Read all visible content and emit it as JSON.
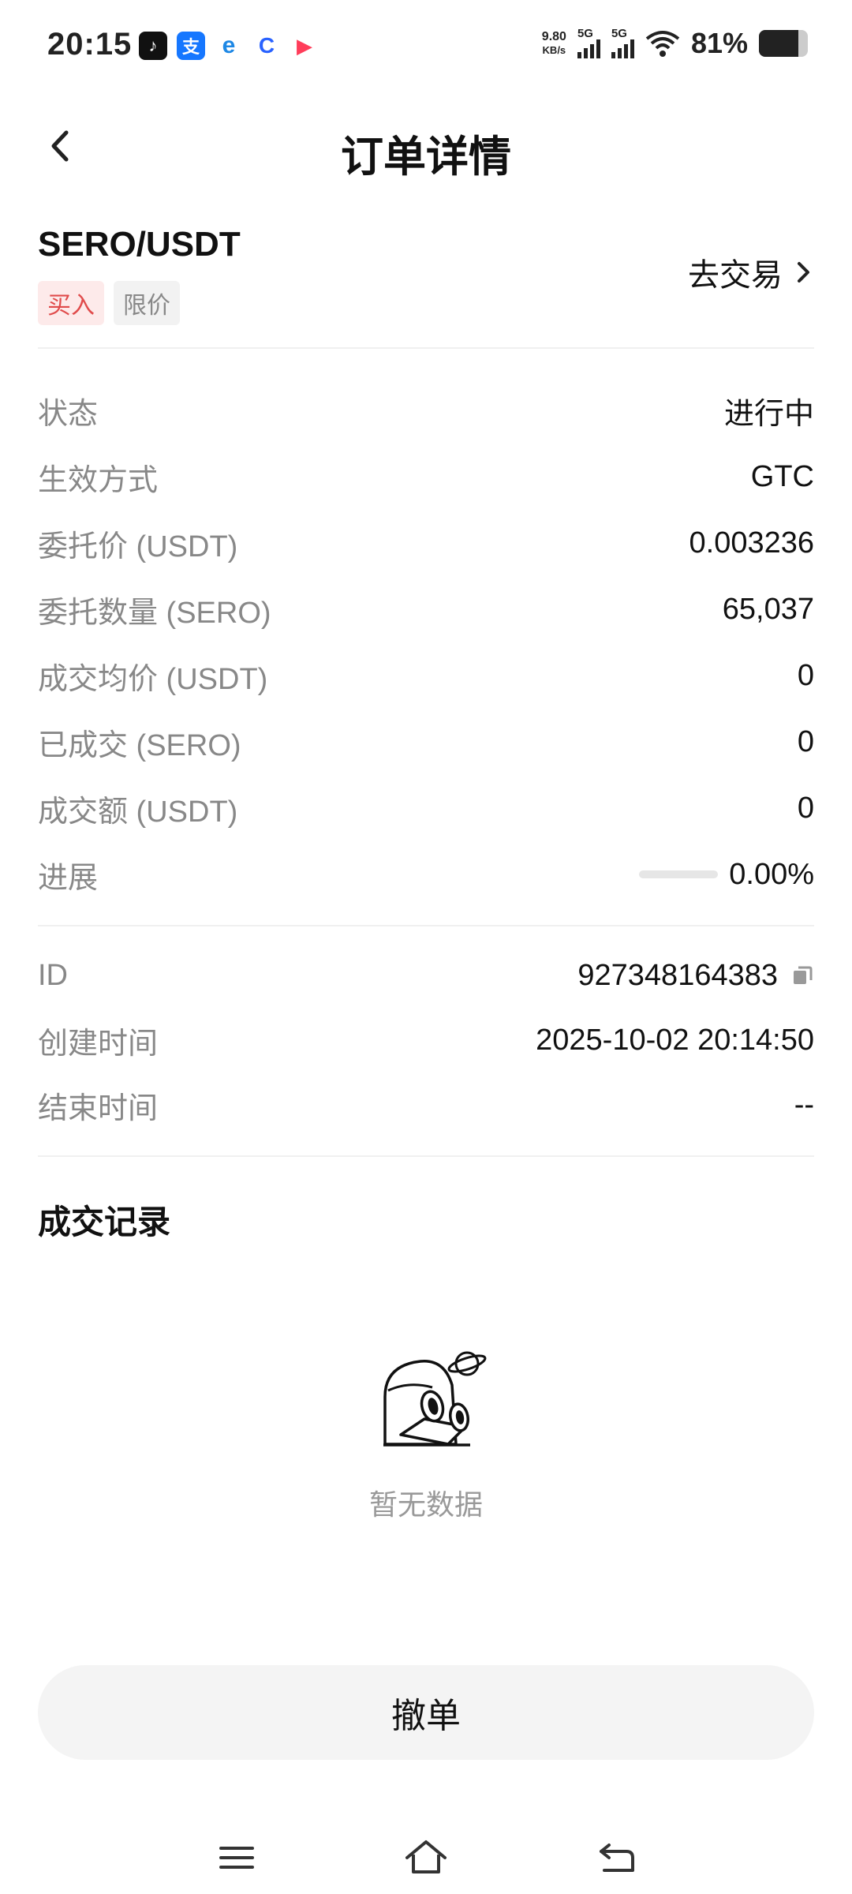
{
  "status_bar": {
    "time": "20:15",
    "net_speed_value": "9.80",
    "net_speed_unit": "KB/s",
    "sim1": "5G",
    "sim2": "5G",
    "battery_percent": "81%",
    "apps": [
      "tiktok-icon",
      "alipay-icon",
      "edge-browser-icon",
      "baidu-map-icon",
      "video-app-icon"
    ]
  },
  "header": {
    "title": "订单详情"
  },
  "order": {
    "pair": "SERO/USDT",
    "side_tag": "买入",
    "type_tag": "限价",
    "trade_link": "去交易"
  },
  "details": [
    {
      "label": "状态",
      "value": "进行中"
    },
    {
      "label": "生效方式",
      "value": "GTC"
    },
    {
      "label": "委托价 (USDT)",
      "value": "0.003236"
    },
    {
      "label": "委托数量 (SERO)",
      "value": "65,037"
    },
    {
      "label": "成交均价 (USDT)",
      "value": "0"
    },
    {
      "label": "已成交 (SERO)",
      "value": "0"
    },
    {
      "label": "成交额 (USDT)",
      "value": "0"
    }
  ],
  "progress": {
    "label": "进展",
    "value": "0.00%",
    "fraction": 0
  },
  "meta": [
    {
      "label": "ID",
      "value": "927348164383"
    },
    {
      "label": "创建时间",
      "value": "2025-10-02 20:14:50"
    },
    {
      "label": "结束时间",
      "value": "--"
    }
  ],
  "trades": {
    "title": "成交记录",
    "empty_text": "暂无数据"
  },
  "actions": {
    "cancel": "撤单"
  },
  "colors": {
    "buy_red": "#e04b4b",
    "buy_tag_bg": "#fdeaea",
    "muted_text": "#888888"
  }
}
